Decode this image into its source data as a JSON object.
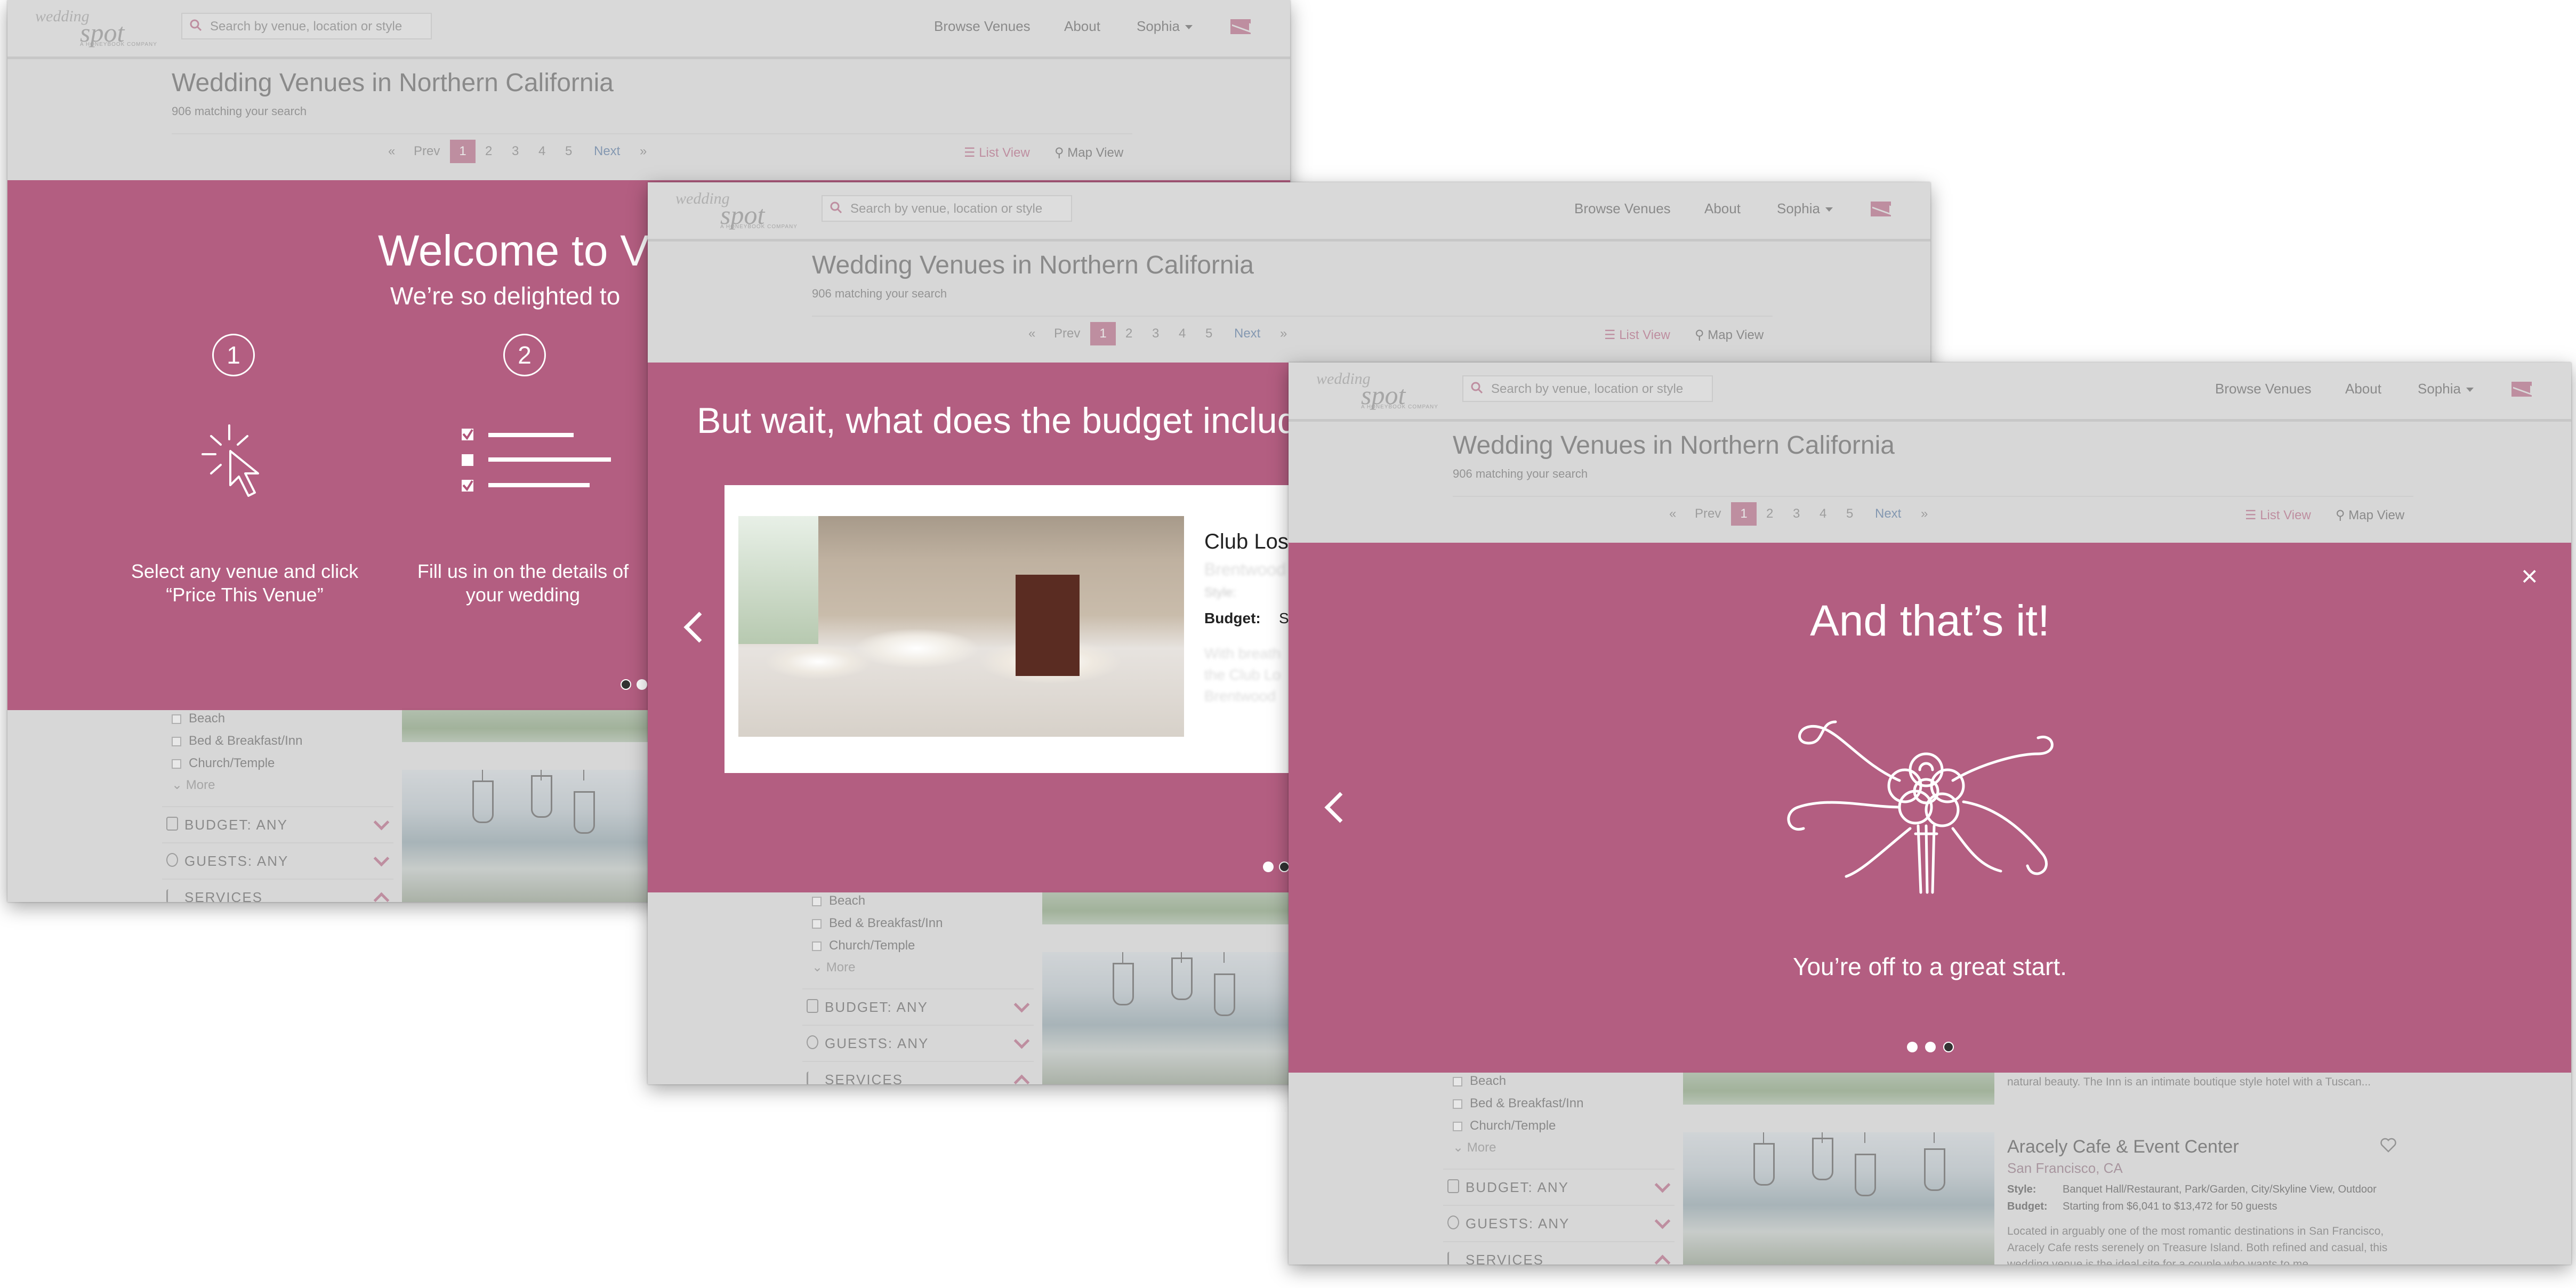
{
  "header": {
    "logo_line1": "wedding",
    "logo_line2": "spot",
    "logo_tagline": "A HONEYBOOK COMPANY",
    "search_placeholder": "Search by venue, location or style",
    "nav_browse": "Browse Venues",
    "nav_about": "About",
    "nav_user": "Sophia"
  },
  "page": {
    "title": "Wedding Venues in Northern California",
    "count": "906 matching your search"
  },
  "pager": {
    "first": "«",
    "prev": "Prev",
    "pages": [
      "1",
      "2",
      "3",
      "4",
      "5"
    ],
    "next": "Next",
    "last": "»",
    "list_view": "List View",
    "map_view": "Map View"
  },
  "sidebar": {
    "options": [
      "Beach",
      "Bed & Breakfast/Inn",
      "Church/Temple"
    ],
    "more": "More",
    "facets": [
      "BUDGET: ANY",
      "GUESTS: ANY",
      "SERVICES"
    ]
  },
  "overlay1": {
    "title": "Welcome to V",
    "subtitle": "We’re so delighted to",
    "step1_num": "1",
    "step1_text": "Select any venue and click “Price This Venue”",
    "step2_num": "2",
    "step2_text": "Fill us in on the details of your wedding"
  },
  "overlay2": {
    "title": "But wait, what does the budget includ",
    "card_title": "Club Los",
    "card_style_label": "Style:",
    "card_budget_label": "Budget:",
    "card_budget_value": "S"
  },
  "overlay3": {
    "title": "And that’s it!",
    "subtitle": "You’re off to a great start.",
    "close": "×"
  },
  "venues": [
    {
      "desc": "natural beauty. The Inn is an intimate boutique style hotel with a Tuscan..."
    },
    {
      "name": "Aracely Cafe & Event Center",
      "location": "San Francisco, CA",
      "style_label": "Style:",
      "style": "Banquet Hall/Restaurant, Park/Garden, City/Skyline View, Outdoor",
      "budget_label": "Budget:",
      "budget": "Starting from $6,041 to $13,472 for 50 guests",
      "desc": "Located in arguably one of the most romantic destinations in San Francisco, Aracely Cafe rests serenely on Treasure Island. Both refined and casual, this wedding venue is the ideal site for a couple who wants to me..."
    }
  ],
  "colors": {
    "accent": "#b35c7c",
    "overlay": "#b05479",
    "background": "#e1e1e1"
  },
  "carousel": {
    "slide1_active": 1,
    "slide2_active": 2,
    "slide3_active": 3,
    "total": 3
  }
}
